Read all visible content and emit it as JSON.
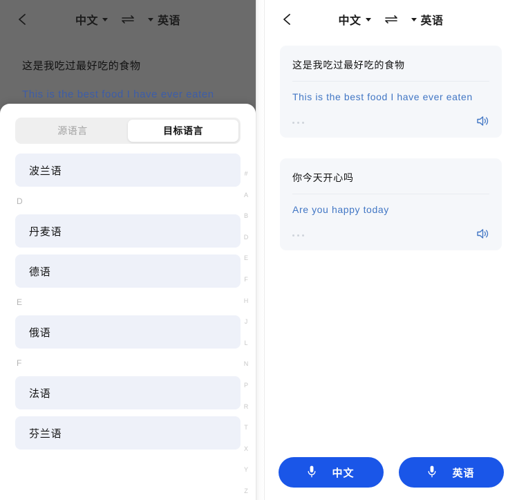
{
  "left_screen": {
    "header": {
      "back_icon": "back-chevron-icon",
      "source_lang": "中文",
      "swap_icon": "swap-arrows-icon",
      "target_lang": "英语"
    },
    "background_content": {
      "source_text": "这是我吃过最好吃的食物",
      "target_text": "This is the best food I have ever eaten"
    },
    "sheet": {
      "tabs": [
        {
          "label": "源语言",
          "active": false
        },
        {
          "label": "目标语言",
          "active": true
        }
      ],
      "list": [
        {
          "type": "item",
          "label": "波兰语"
        },
        {
          "type": "section",
          "label": "D"
        },
        {
          "type": "item",
          "label": "丹麦语"
        },
        {
          "type": "item",
          "label": "德语"
        },
        {
          "type": "section",
          "label": "E"
        },
        {
          "type": "item",
          "label": "俄语"
        },
        {
          "type": "section",
          "label": "F"
        },
        {
          "type": "item",
          "label": "法语"
        },
        {
          "type": "item",
          "label": "芬兰语"
        }
      ],
      "index_letters": [
        "#",
        "A",
        "B",
        "D",
        "E",
        "F",
        "H",
        "J",
        "L",
        "N",
        "P",
        "R",
        "T",
        "X",
        "Y",
        "Z"
      ]
    }
  },
  "right_screen": {
    "header": {
      "back_icon": "back-chevron-icon",
      "source_lang": "中文",
      "swap_icon": "swap-arrows-icon",
      "target_lang": "英语"
    },
    "cards": [
      {
        "source_text": "这是我吃过最好吃的食物",
        "target_text": "This is the best food I have ever eaten",
        "more_icon": "more-dots-icon",
        "speaker_icon": "speaker-icon"
      },
      {
        "source_text": "你今天开心吗",
        "target_text": "Are you happy today",
        "more_icon": "more-dots-icon",
        "speaker_icon": "speaker-icon"
      }
    ],
    "mic_buttons": [
      {
        "label": "中文",
        "icon": "microphone-icon"
      },
      {
        "label": "英语",
        "icon": "microphone-icon"
      }
    ]
  },
  "colors": {
    "accent_blue": "#1a56e8",
    "translation_text": "#4176c4",
    "list_item_bg": "#eef1f9",
    "card_bg": "#f5f7fa",
    "overlay": "#6b6b6b"
  }
}
